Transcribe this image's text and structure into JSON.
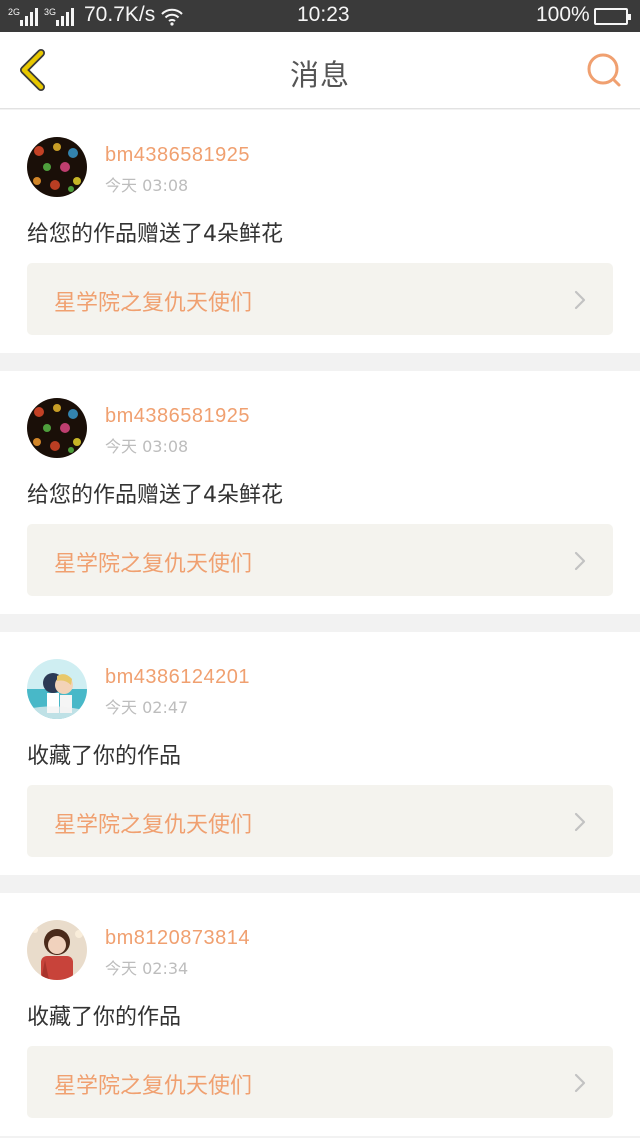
{
  "status_bar": {
    "net_tag_1": "2G",
    "net_tag_2": "3G",
    "speed": "70.7K/s",
    "time": "10:23",
    "battery": "100%"
  },
  "header": {
    "title": "消息",
    "back_icon": "chevron-left-icon",
    "search_icon": "search-icon"
  },
  "colors": {
    "accent": "#f0a070",
    "back_icon": "#e8c800",
    "work_link_bg": "#f4f3ee"
  },
  "messages": [
    {
      "username": "bm4386581925",
      "time": "今天 03:08",
      "message": "给您的作品赠送了4朵鲜花",
      "work_title": "星学院之复仇天使们",
      "avatar": "bokeh-lights-avatar"
    },
    {
      "username": "bm4386581925",
      "time": "今天 03:08",
      "message": "给您的作品赠送了4朵鲜花",
      "work_title": "星学院之复仇天使们",
      "avatar": "bokeh-lights-avatar"
    },
    {
      "username": "bm4386124201",
      "time": "今天 02:47",
      "message": "收藏了你的作品",
      "work_title": "星学院之复仇天使们",
      "avatar": "anime-couple-avatar"
    },
    {
      "username": "bm8120873814",
      "time": "今天 02:34",
      "message": "收藏了你的作品",
      "work_title": "星学院之复仇天使们",
      "avatar": "girl-photo-avatar"
    }
  ]
}
